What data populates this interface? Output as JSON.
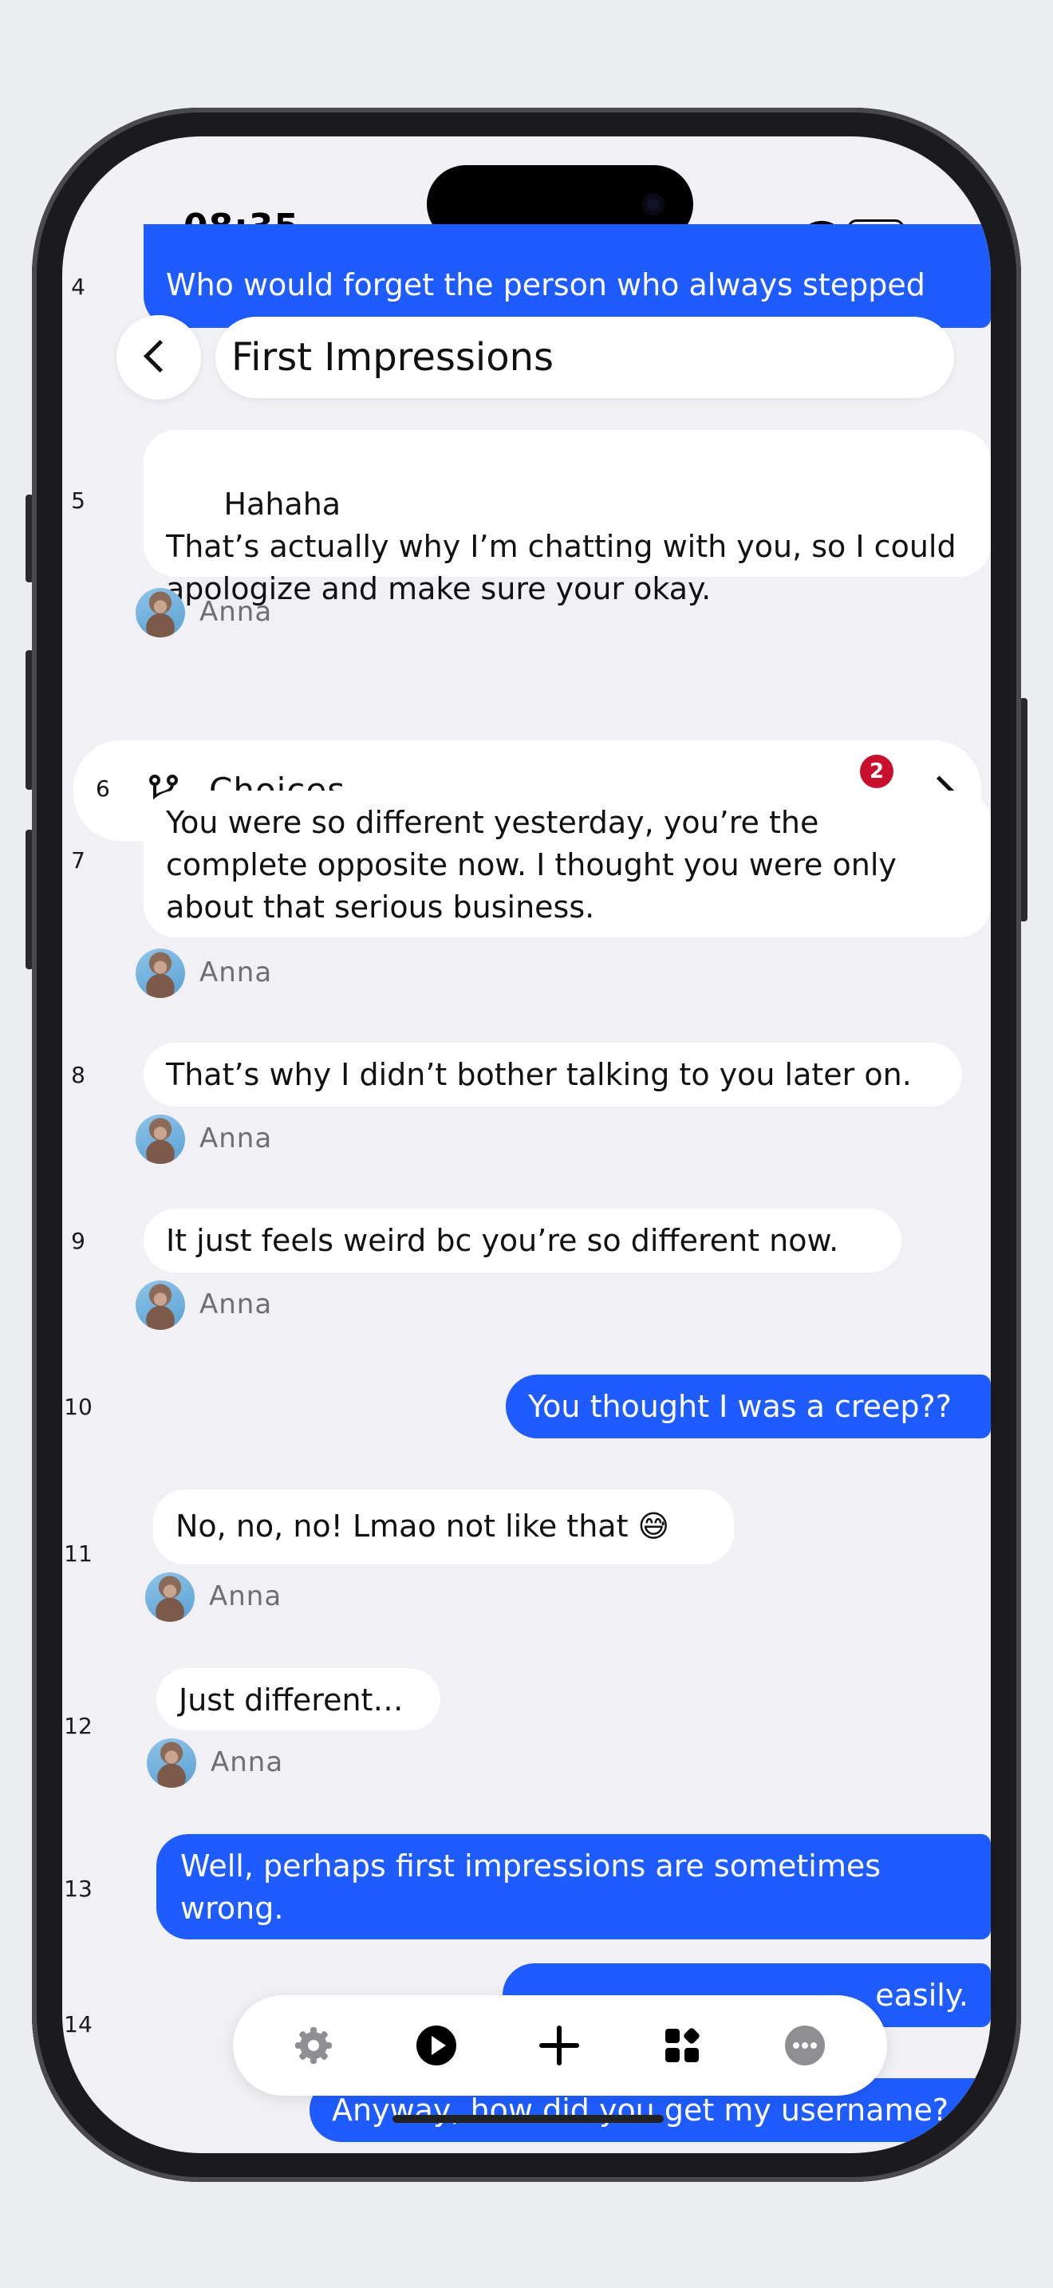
{
  "status_bar": {
    "time": "08:35",
    "signal_dots": "••••"
  },
  "header": {
    "back_label": "",
    "title": "First Impressions"
  },
  "top_partial_message": {
    "line": "4",
    "text": "Who would forget the person who always stepped"
  },
  "messages": [
    {
      "line": "5",
      "text": "Hahaha\nThat’s actually why I’m chatting with you, so I could apologize and make sure your okay.",
      "sender": "Anna"
    },
    {
      "line": "7",
      "text": "You were so different yesterday, you’re the complete opposite now. I thought you were only about that serious business.",
      "sender": "Anna"
    },
    {
      "line": "8",
      "text": "That’s why I didn’t bother talking to you later on.",
      "sender": "Anna"
    },
    {
      "line": "9",
      "text": "It just feels weird bc you’re so different now.",
      "sender": "Anna"
    },
    {
      "line": "10",
      "text": "You thought I was a creep??"
    },
    {
      "line": "11",
      "text": "No, no, no! Lmao not like that 😅",
      "sender": "Anna"
    },
    {
      "line": "12",
      "text": "Just different…",
      "sender": "Anna"
    },
    {
      "line": "13",
      "text": "Well, perhaps first impressions are sometimes wrong."
    },
    {
      "line": "14",
      "text": "easily."
    },
    {
      "line": "",
      "text": "Anyway, how did you get my username?"
    }
  ],
  "choices": {
    "line": "6",
    "label": "Choices",
    "badge_count": "2"
  },
  "toolbar": {
    "items": [
      {
        "name": "settings-gear-icon"
      },
      {
        "name": "play-icon"
      },
      {
        "name": "add-plus-icon"
      },
      {
        "name": "widgets-grid-icon"
      },
      {
        "name": "more-ellipsis-icon"
      }
    ]
  },
  "colors": {
    "accent_blue": "#1f5cff",
    "badge_red": "#c8102e",
    "screen_bg": "#f0f0f5",
    "bubble_white": "#ffffff"
  }
}
